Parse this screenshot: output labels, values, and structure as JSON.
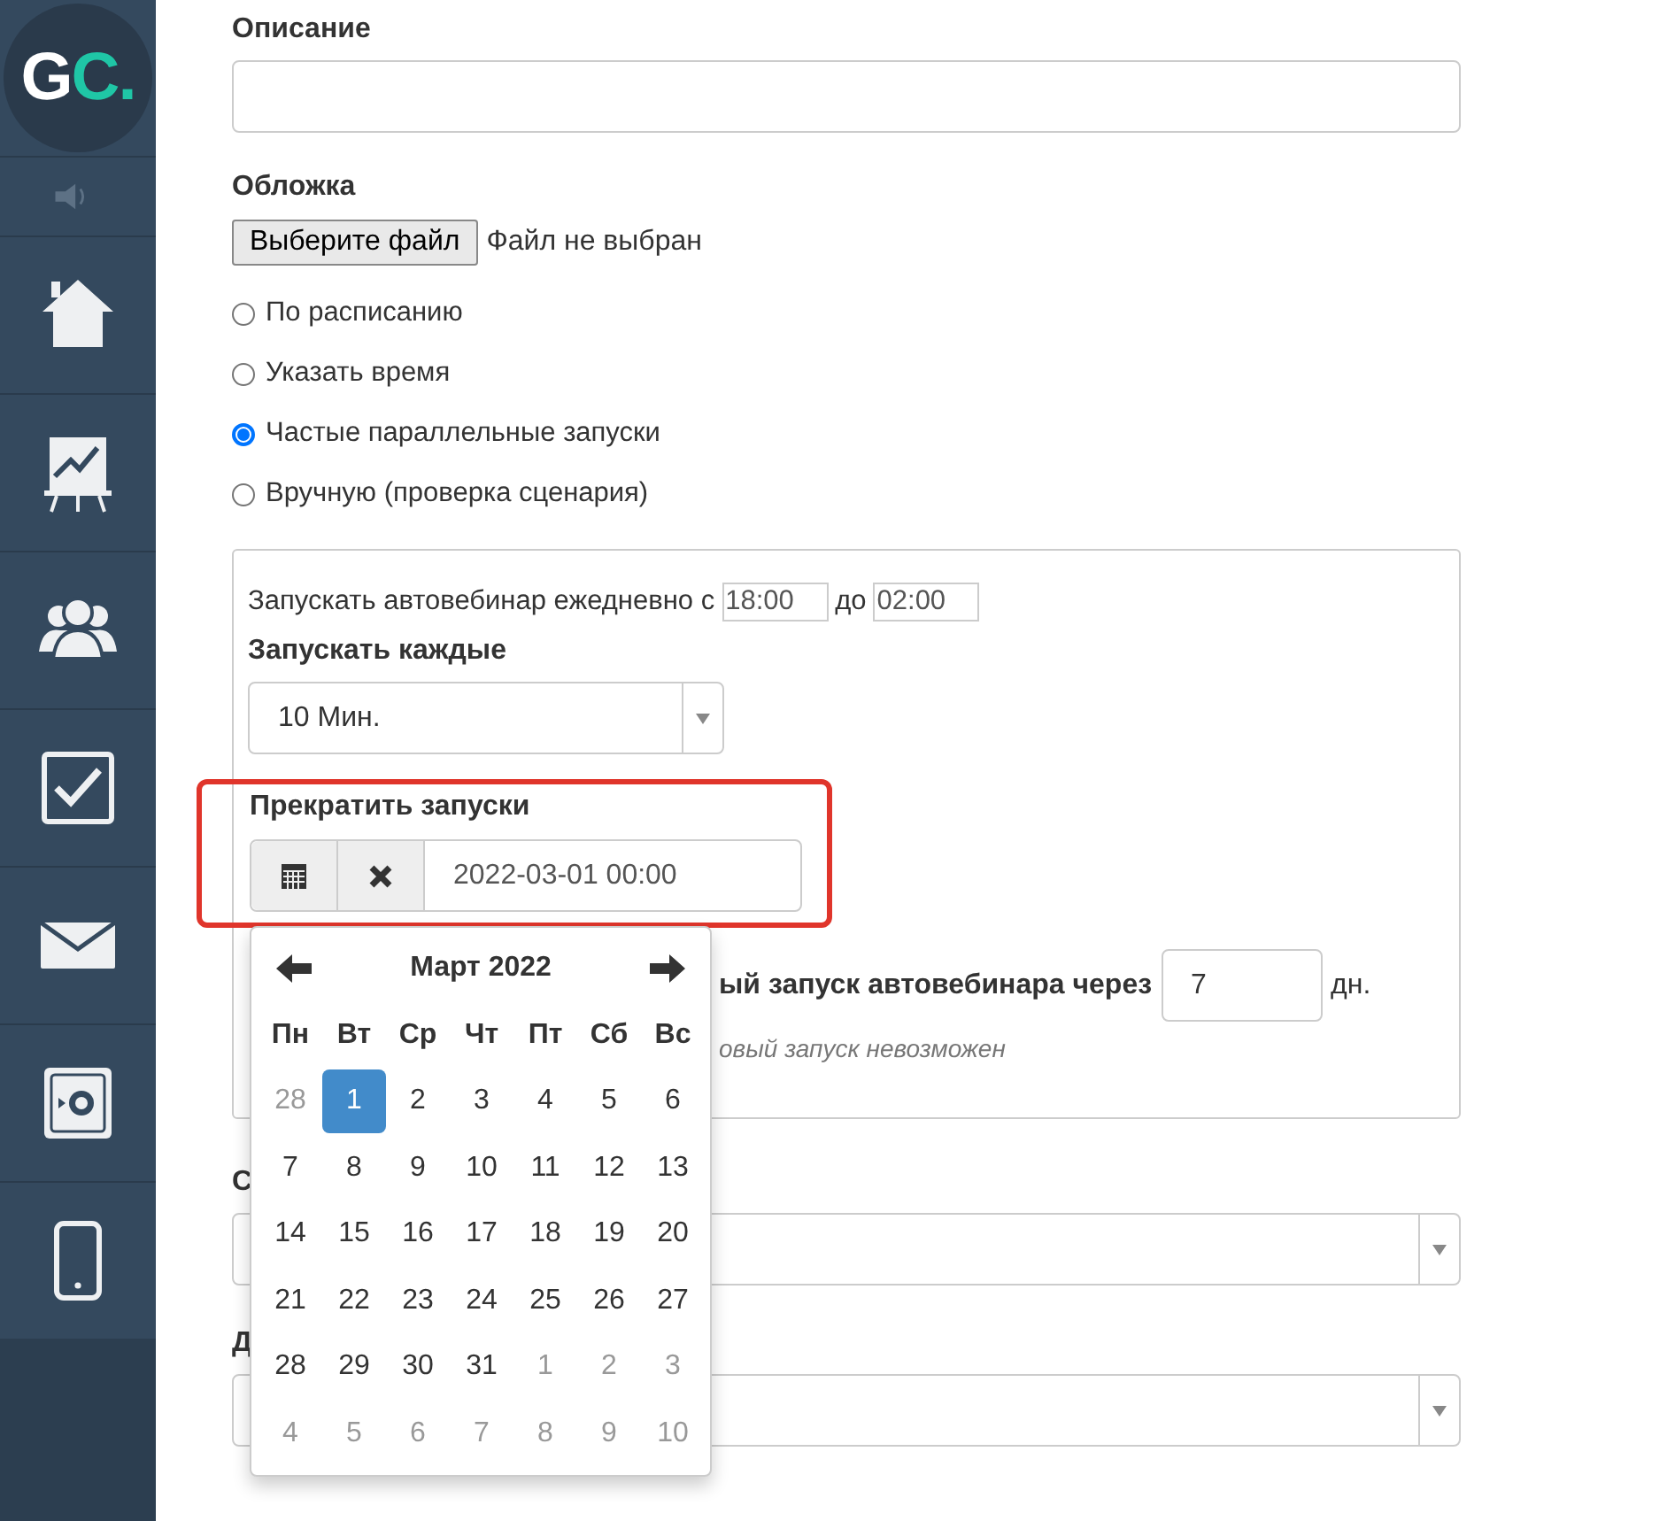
{
  "sidebar": {
    "logo": {
      "main": "G",
      "accent": "C."
    },
    "items": [
      {
        "selected": false
      },
      {
        "selected": false
      },
      {
        "selected": false
      },
      {
        "selected": false
      },
      {
        "selected": false
      },
      {
        "selected": false
      },
      {
        "selected": false
      },
      {
        "selected": false
      }
    ]
  },
  "description": {
    "label": "Описание"
  },
  "cover": {
    "label": "Обложка",
    "button": "Выберите файл",
    "status": "Файл не выбран"
  },
  "launch_modes": [
    {
      "label": "По расписанию",
      "selected": false
    },
    {
      "label": "Указать время",
      "selected": false
    },
    {
      "label": "Частые параллельные запуски",
      "selected": true
    },
    {
      "label": "Вручную (проверка сценария)",
      "selected": false
    }
  ],
  "schedule": {
    "daily_prefix": "Запускать автовебинар ежедневно с",
    "from": "18:00",
    "to_label": "до",
    "to": "02:00",
    "every_label": "Запускать каждые",
    "every_value": "10 Мин.",
    "stop_label": "Прекратить запуски",
    "stop_value": "2022-03-01 00:00",
    "highlighted": true,
    "next_label": "ый запуск автовебинара через",
    "next_value": "7",
    "next_unit": "дн.",
    "note": "овый запуск невозможен"
  },
  "calendar": {
    "month": "Март 2022",
    "weekdays": [
      "Пн",
      "Вт",
      "Ср",
      "Чт",
      "Пт",
      "Сб",
      "Вс"
    ],
    "weeks": [
      [
        {
          "day": "28",
          "muted": true,
          "selected": false
        },
        {
          "day": "1",
          "muted": false,
          "selected": true
        },
        {
          "day": "2",
          "muted": false,
          "selected": false
        },
        {
          "day": "3",
          "muted": false,
          "selected": false
        },
        {
          "day": "4",
          "muted": false,
          "selected": false
        },
        {
          "day": "5",
          "muted": false,
          "selected": false
        },
        {
          "day": "6",
          "muted": false,
          "selected": false
        }
      ],
      [
        {
          "day": "7",
          "muted": false,
          "selected": false
        },
        {
          "day": "8",
          "muted": false,
          "selected": false
        },
        {
          "day": "9",
          "muted": false,
          "selected": false
        },
        {
          "day": "10",
          "muted": false,
          "selected": false
        },
        {
          "day": "11",
          "muted": false,
          "selected": false
        },
        {
          "day": "12",
          "muted": false,
          "selected": false
        },
        {
          "day": "13",
          "muted": false,
          "selected": false
        }
      ],
      [
        {
          "day": "14",
          "muted": false,
          "selected": false
        },
        {
          "day": "15",
          "muted": false,
          "selected": false
        },
        {
          "day": "16",
          "muted": false,
          "selected": false
        },
        {
          "day": "17",
          "muted": false,
          "selected": false
        },
        {
          "day": "18",
          "muted": false,
          "selected": false
        },
        {
          "day": "19",
          "muted": false,
          "selected": false
        },
        {
          "day": "20",
          "muted": false,
          "selected": false
        }
      ],
      [
        {
          "day": "21",
          "muted": false,
          "selected": false
        },
        {
          "day": "22",
          "muted": false,
          "selected": false
        },
        {
          "day": "23",
          "muted": false,
          "selected": false
        },
        {
          "day": "24",
          "muted": false,
          "selected": false
        },
        {
          "day": "25",
          "muted": false,
          "selected": false
        },
        {
          "day": "26",
          "muted": false,
          "selected": false
        },
        {
          "day": "27",
          "muted": false,
          "selected": false
        }
      ],
      [
        {
          "day": "28",
          "muted": false,
          "selected": false
        },
        {
          "day": "29",
          "muted": false,
          "selected": false
        },
        {
          "day": "30",
          "muted": false,
          "selected": false
        },
        {
          "day": "31",
          "muted": false,
          "selected": false
        },
        {
          "day": "1",
          "muted": true,
          "selected": false
        },
        {
          "day": "2",
          "muted": true,
          "selected": false
        },
        {
          "day": "3",
          "muted": true,
          "selected": false
        }
      ],
      [
        {
          "day": "4",
          "muted": true,
          "selected": false
        },
        {
          "day": "5",
          "muted": true,
          "selected": false
        },
        {
          "day": "6",
          "muted": true,
          "selected": false
        },
        {
          "day": "7",
          "muted": true,
          "selected": false
        },
        {
          "day": "8",
          "muted": true,
          "selected": false
        },
        {
          "day": "9",
          "muted": true,
          "selected": false
        },
        {
          "day": "10",
          "muted": true,
          "selected": false
        }
      ]
    ]
  },
  "lower_fields": [
    {
      "label": "С"
    },
    {
      "label": "Д"
    }
  ]
}
